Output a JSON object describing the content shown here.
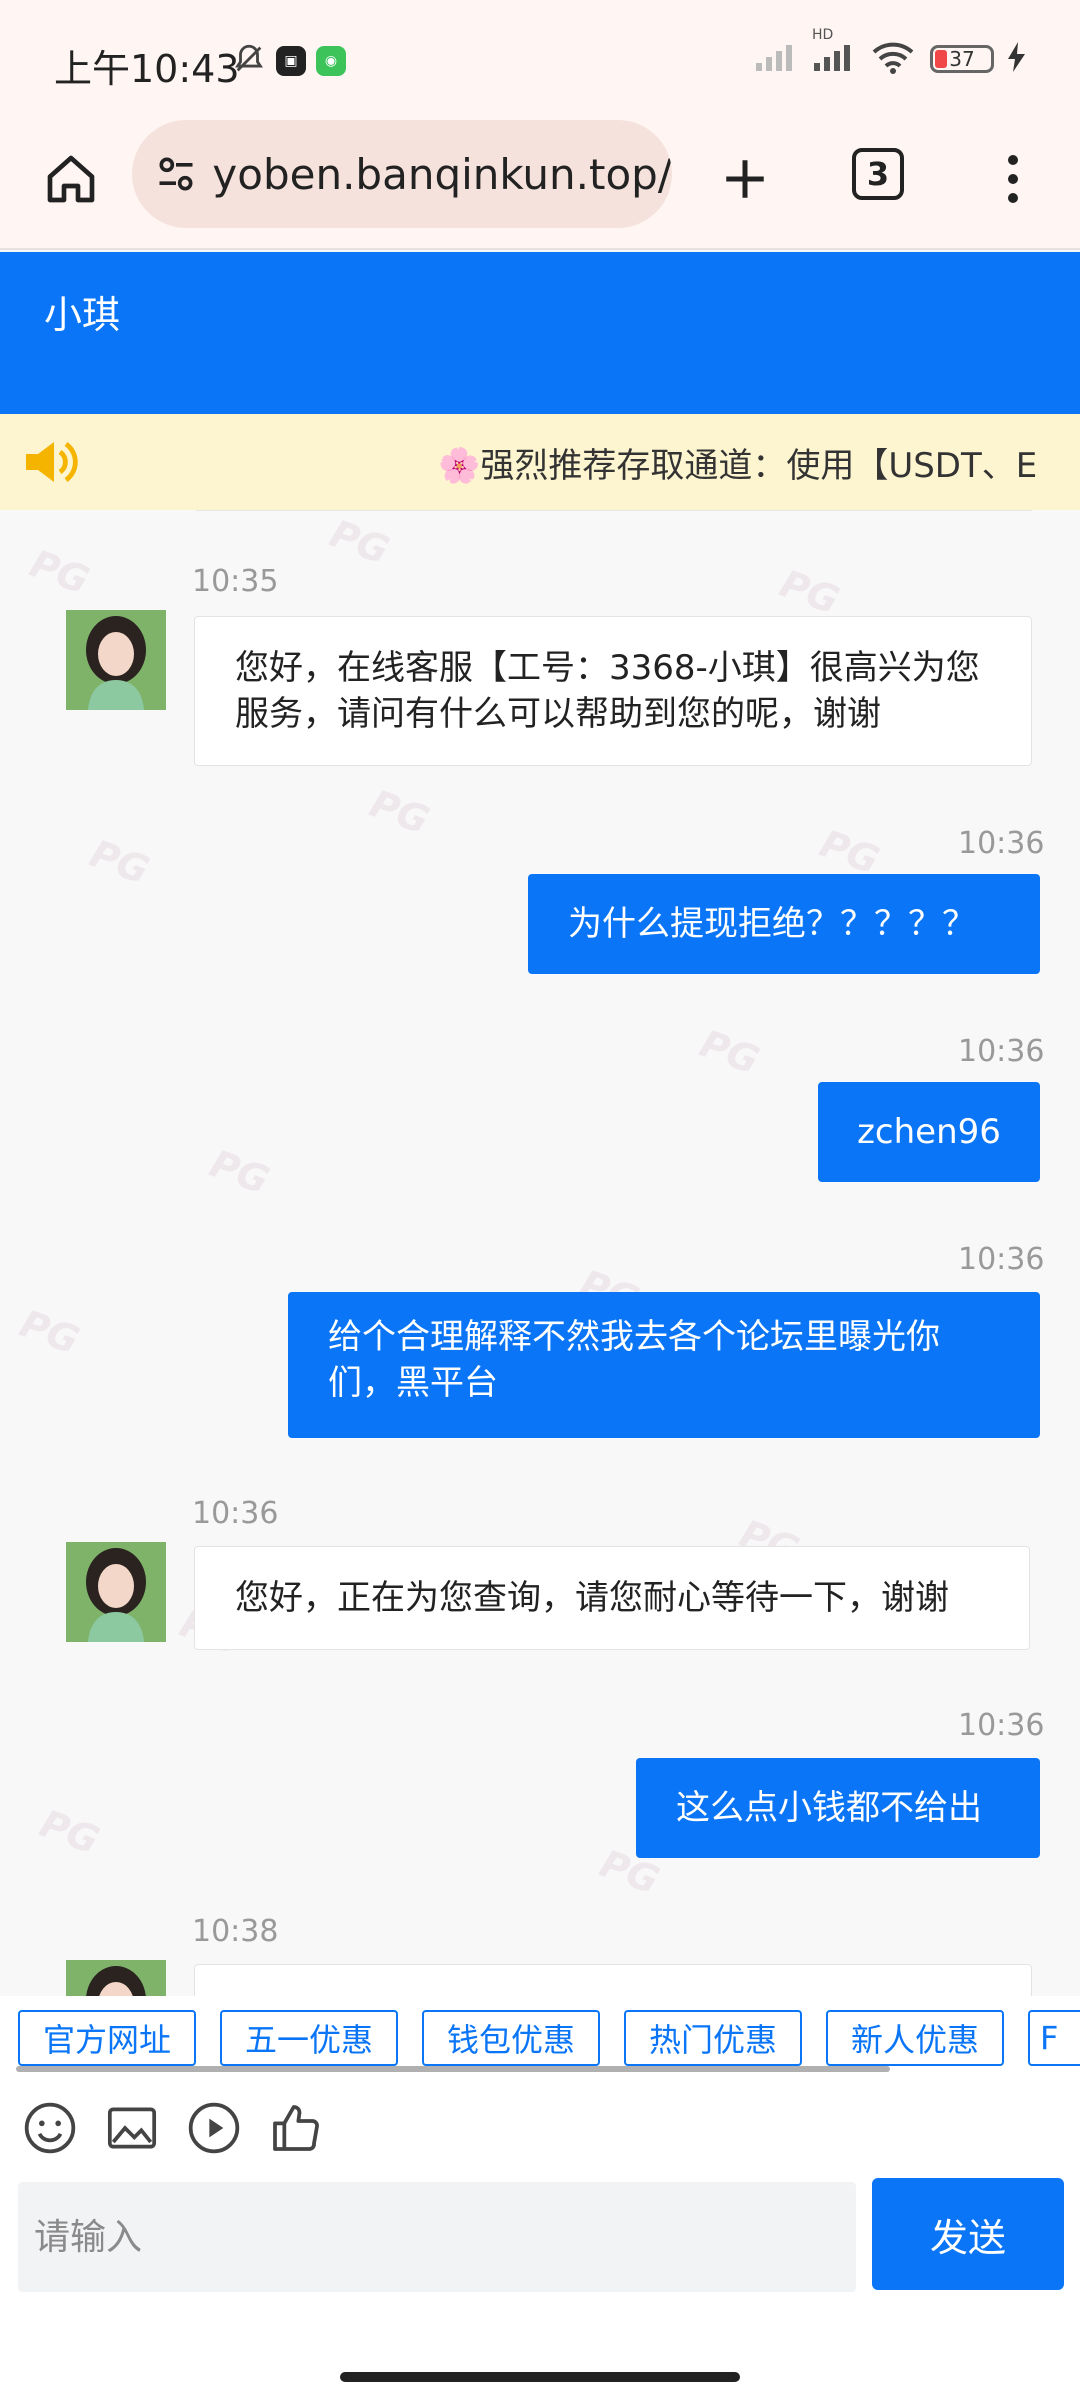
{
  "status_bar": {
    "time": "上午10:43",
    "battery_level": "37",
    "network_label": "HD"
  },
  "browser": {
    "url": "yoben.banqinkun.top/",
    "tab_count": "3",
    "icons": [
      "home-icon",
      "site-settings-icon",
      "plus-icon",
      "tabs-icon",
      "more-vert-icon"
    ]
  },
  "chat": {
    "agent_name": "小琪",
    "notice": "🌸强烈推荐存取通道：使用【USDT、E",
    "watermark": "PG",
    "messages": [
      {
        "side": "in",
        "time": "10:35",
        "text": "您好，在线客服【工号：3368-小琪】很高兴为您服务，请问有什么可以帮助到您的呢，谢谢"
      },
      {
        "side": "out",
        "time": "10:36",
        "text": "为什么提现拒绝？？？？？"
      },
      {
        "side": "out",
        "time": "10:36",
        "text": "zchen96"
      },
      {
        "side": "out",
        "time": "10:36",
        "text": "给个合理解释不然我去各个论坛里曝光你们，黑平台"
      },
      {
        "side": "in",
        "time": "10:36",
        "text": "您好，正在为您查询，请您耐心等待一下，谢谢"
      },
      {
        "side": "out",
        "time": "10:36",
        "text": "这么点小钱都不给出"
      },
      {
        "side": "in",
        "time": "10:38",
        "text": ""
      }
    ]
  },
  "quick_tags": [
    "官方网址",
    "五一优惠",
    "钱包优惠",
    "热门优惠",
    "新人优惠",
    "F"
  ],
  "tools": [
    "emoji-icon",
    "image-icon",
    "video-icon",
    "thumbs-up-icon"
  ],
  "input": {
    "placeholder": "请输入",
    "value": "",
    "send_label": "发送"
  },
  "colors": {
    "accent": "#0a75f6",
    "notice_bg": "#fdf5d0",
    "status_bg": "#fff6f3",
    "url_pill_bg": "#f5e2dc"
  }
}
